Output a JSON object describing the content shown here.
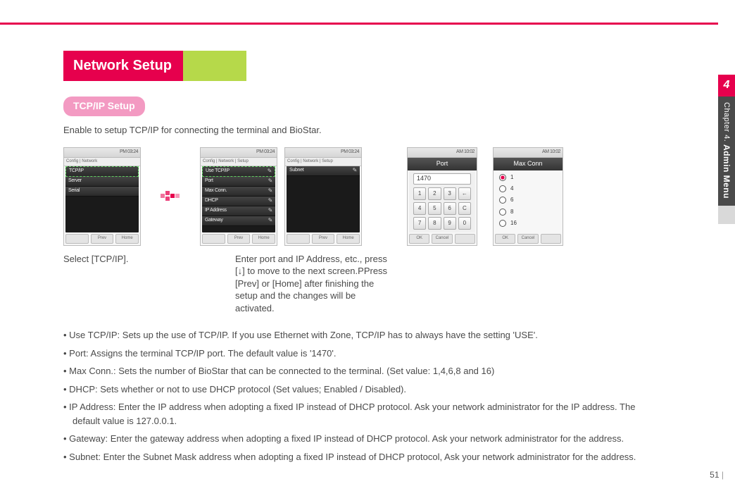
{
  "page_number": "51",
  "chapter": {
    "num": "4",
    "pre": "Chapter 4.",
    "title": "Admin Menu"
  },
  "heading": "Network Setup",
  "subheading": "TCP/IP Setup",
  "intro": "Enable to setup TCP/IP for connecting the terminal and BioStar.",
  "shot1": {
    "status": "PM 03:24",
    "crumb": "Config | Network",
    "rows": [
      "TCP/IP",
      "Server",
      "Serial"
    ],
    "foot": [
      "",
      "Prev",
      "Home"
    ]
  },
  "shot2a": {
    "status": "PM 03:24",
    "crumb": "Config | Network | Setup",
    "rows": [
      "Use TCP/IP",
      "Port",
      "Max Conn.",
      "DHCP",
      "IP Address",
      "Gateway"
    ],
    "foot": [
      "",
      "Prev",
      "Home"
    ]
  },
  "shot2b": {
    "status": "PM 03:24",
    "crumb": "Config | Network | Setup",
    "rows": [
      "Subnet"
    ],
    "foot": [
      "",
      "Prev",
      "Home"
    ]
  },
  "port": {
    "title": "Port",
    "status": "AM 10:02",
    "value": "1470",
    "keys": [
      "1",
      "2",
      "3",
      "←",
      "4",
      "5",
      "6",
      "C",
      "7",
      "8",
      "9",
      "0"
    ],
    "foot": [
      "OK",
      "Cancel",
      ""
    ]
  },
  "maxconn": {
    "title": "Max Conn",
    "status": "AM 10:02",
    "opts": [
      "1",
      "4",
      "6",
      "8",
      "16"
    ],
    "foot": [
      "OK",
      "Cancel",
      ""
    ]
  },
  "captions": {
    "a": "Select [TCP/IP].",
    "b": "Enter port and IP Address, etc., press [↓] to move to the next screen.PPress [Prev] or [Home] after finishing the setup and the changes will be activated."
  },
  "bullets": [
    "Use TCP/IP: Sets up the use of TCP/IP. If you use Ethernet with Zone, TCP/IP has to always have the setting 'USE'.",
    "Port: Assigns the terminal TCP/IP port. The default value is '1470'.",
    "Max Conn.: Sets the number of BioStar that can be connected to the terminal. (Set value: 1,4,6,8 and 16)",
    "DHCP: Sets whether or not to use DHCP protocol (Set values; Enabled / Disabled).",
    "IP Address: Enter the IP address when adopting a fixed IP instead of DHCP protocol. Ask your network administrator for the IP address. The default value is 127.0.0.1.",
    "Gateway: Enter the gateway address when adopting a fixed IP instead of DHCP protocol. Ask your network administrator for the address.",
    "Subnet: Enter the Subnet Mask address when adopting a fixed IP instead of DHCP protocol, Ask your network administrator for the address."
  ]
}
